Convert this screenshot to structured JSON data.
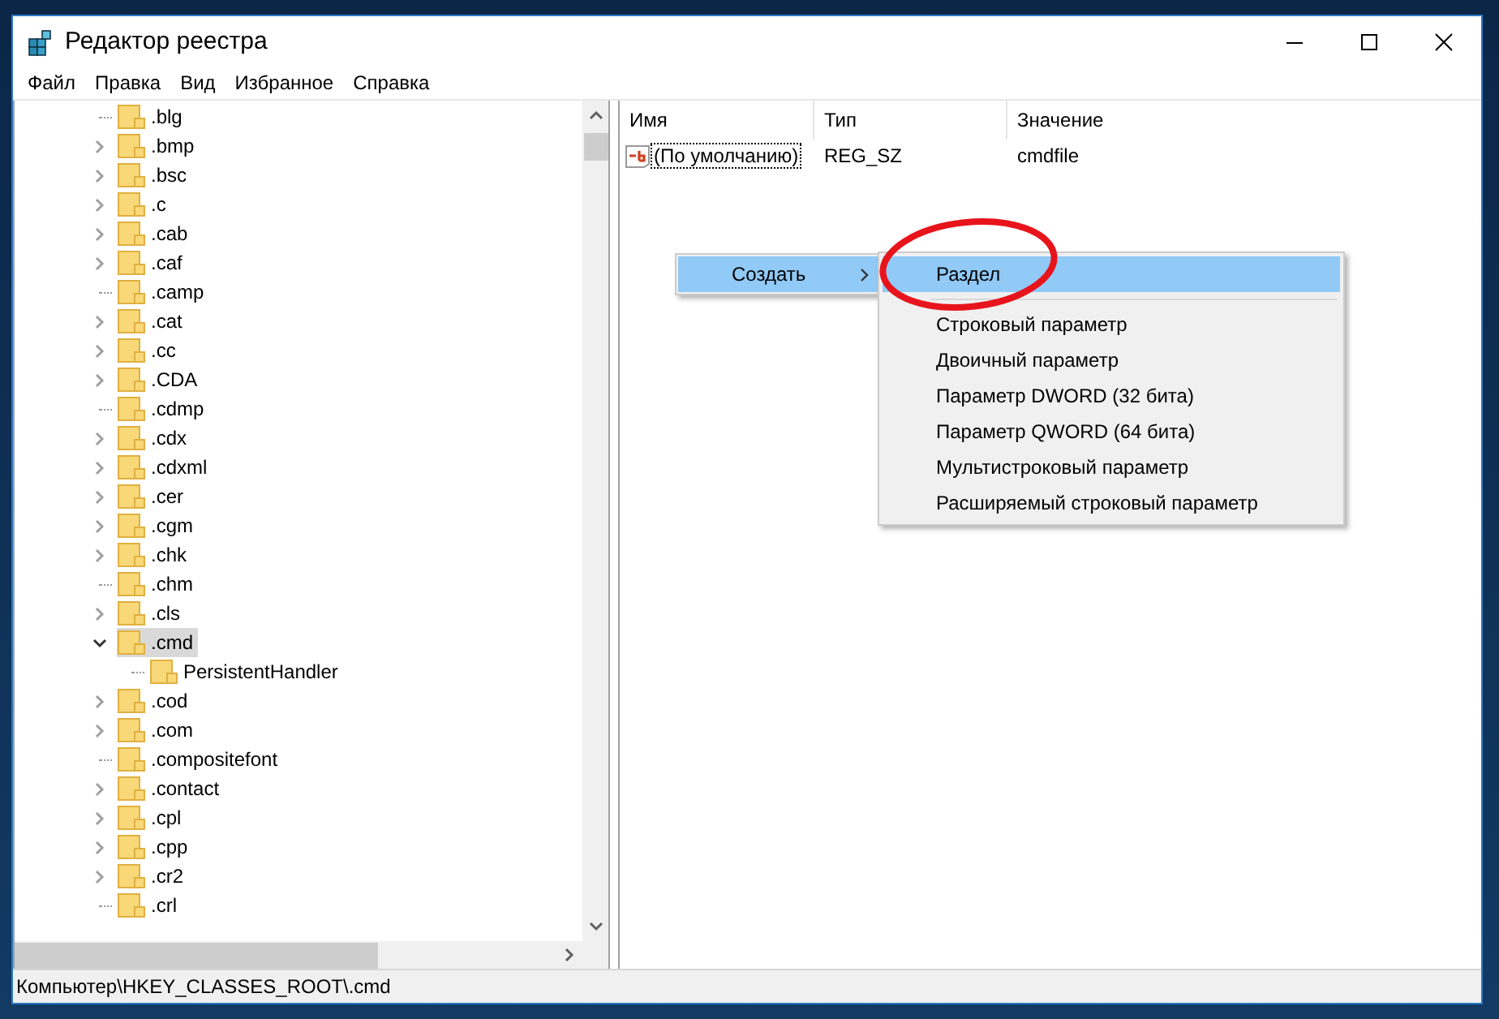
{
  "window": {
    "title": "Редактор реестра"
  },
  "menu_bar": [
    "Файл",
    "Правка",
    "Вид",
    "Избранное",
    "Справка"
  ],
  "tree": [
    {
      "label": ".blg",
      "expandable": false,
      "expanded": false,
      "selected": false
    },
    {
      "label": ".bmp",
      "expandable": true,
      "expanded": false,
      "selected": false
    },
    {
      "label": ".bsc",
      "expandable": true,
      "expanded": false,
      "selected": false
    },
    {
      "label": ".c",
      "expandable": true,
      "expanded": false,
      "selected": false
    },
    {
      "label": ".cab",
      "expandable": true,
      "expanded": false,
      "selected": false
    },
    {
      "label": ".caf",
      "expandable": true,
      "expanded": false,
      "selected": false
    },
    {
      "label": ".camp",
      "expandable": false,
      "expanded": false,
      "selected": false
    },
    {
      "label": ".cat",
      "expandable": true,
      "expanded": false,
      "selected": false
    },
    {
      "label": ".cc",
      "expandable": true,
      "expanded": false,
      "selected": false
    },
    {
      "label": ".CDA",
      "expandable": true,
      "expanded": false,
      "selected": false
    },
    {
      "label": ".cdmp",
      "expandable": false,
      "expanded": false,
      "selected": false
    },
    {
      "label": ".cdx",
      "expandable": true,
      "expanded": false,
      "selected": false
    },
    {
      "label": ".cdxml",
      "expandable": true,
      "expanded": false,
      "selected": false
    },
    {
      "label": ".cer",
      "expandable": true,
      "expanded": false,
      "selected": false
    },
    {
      "label": ".cgm",
      "expandable": true,
      "expanded": false,
      "selected": false
    },
    {
      "label": ".chk",
      "expandable": true,
      "expanded": false,
      "selected": false
    },
    {
      "label": ".chm",
      "expandable": false,
      "expanded": false,
      "selected": false
    },
    {
      "label": ".cls",
      "expandable": true,
      "expanded": false,
      "selected": false
    },
    {
      "label": ".cmd",
      "expandable": true,
      "expanded": true,
      "selected": true,
      "children": [
        {
          "label": "PersistentHandler",
          "expandable": false,
          "expanded": false,
          "selected": false
        }
      ]
    },
    {
      "label": ".cod",
      "expandable": true,
      "expanded": false,
      "selected": false
    },
    {
      "label": ".com",
      "expandable": true,
      "expanded": false,
      "selected": false
    },
    {
      "label": ".compositefont",
      "expandable": false,
      "expanded": false,
      "selected": false
    },
    {
      "label": ".contact",
      "expandable": true,
      "expanded": false,
      "selected": false
    },
    {
      "label": ".cpl",
      "expandable": true,
      "expanded": false,
      "selected": false
    },
    {
      "label": ".cpp",
      "expandable": true,
      "expanded": false,
      "selected": false
    },
    {
      "label": ".cr2",
      "expandable": true,
      "expanded": false,
      "selected": false
    },
    {
      "label": ".crl",
      "expandable": false,
      "expanded": false,
      "selected": false
    }
  ],
  "values_table": {
    "columns": [
      "Имя",
      "Тип",
      "Значение"
    ],
    "rows": [
      {
        "name": "(По умолчанию)",
        "type": "REG_SZ",
        "value": "cmdfile",
        "focused": true
      }
    ]
  },
  "context_menu": {
    "items": [
      {
        "label": "Создать",
        "selected": true,
        "submenu": true
      }
    ]
  },
  "submenu": {
    "items": [
      {
        "kind": "item",
        "label": "Раздел",
        "selected": true
      },
      {
        "kind": "separator"
      },
      {
        "kind": "item",
        "label": "Строковый параметр",
        "selected": false
      },
      {
        "kind": "item",
        "label": "Двоичный параметр",
        "selected": false
      },
      {
        "kind": "item",
        "label": "Параметр DWORD (32 бита)",
        "selected": false
      },
      {
        "kind": "item",
        "label": "Параметр QWORD (64 бита)",
        "selected": false
      },
      {
        "kind": "item",
        "label": "Мультистроковый параметр",
        "selected": false
      },
      {
        "kind": "item",
        "label": "Расширяемый строковый параметр",
        "selected": false
      }
    ]
  },
  "status_bar": "Компьютер\\HKEY_CLASSES_ROOT\\.cmd"
}
